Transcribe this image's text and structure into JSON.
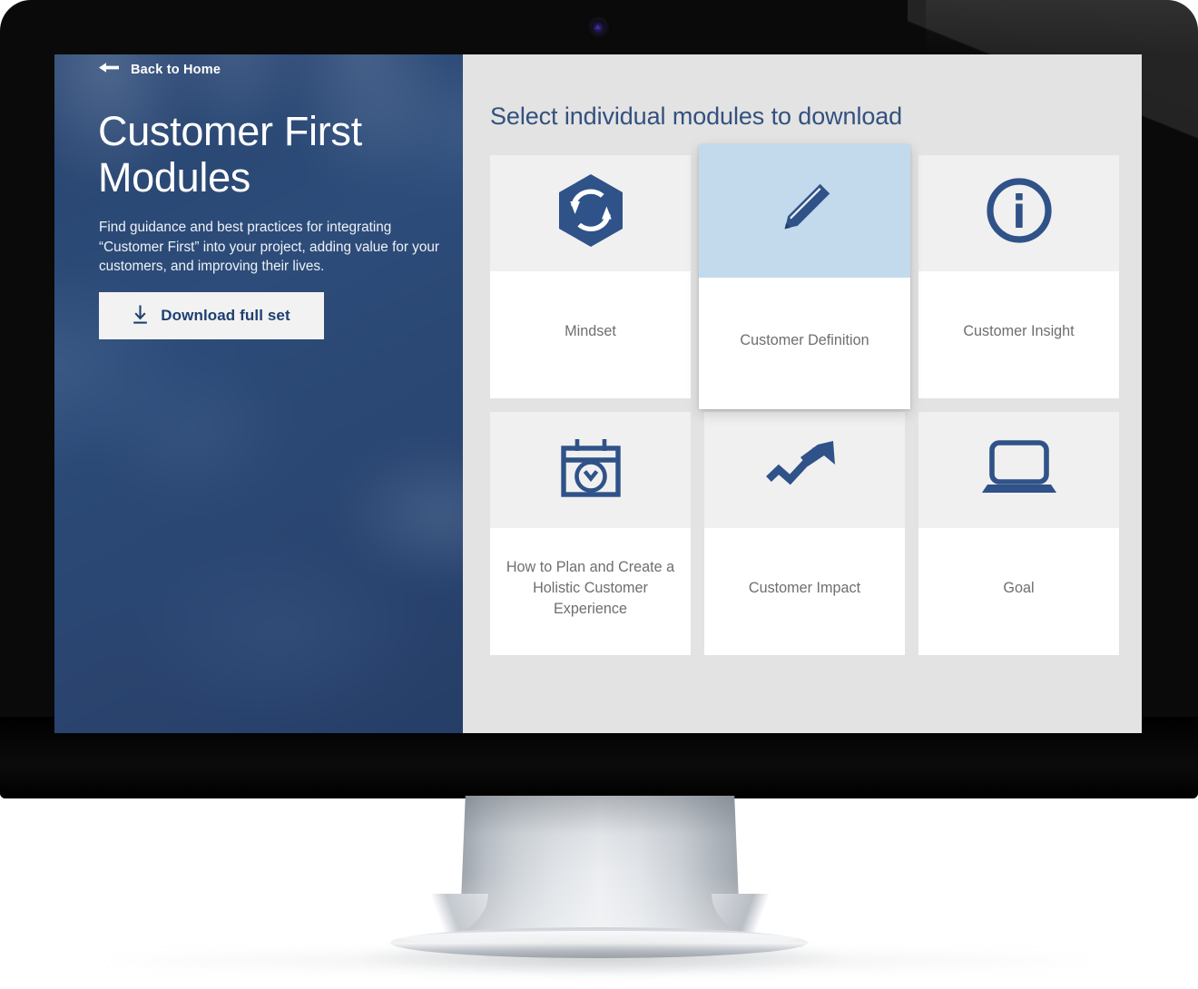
{
  "hero": {
    "back_link_label": "Back to Home",
    "back_arrow_icon": "arrow-left-icon",
    "title": "Customer First Modules",
    "description": "Find guidance and best practices for integrating “Customer First” into your project, adding value for your customers, and improving their lives.",
    "download_button_label": "Download full set",
    "download_button_icon": "download-icon",
    "background_color": "#2a4670",
    "text_color": "#ffffff"
  },
  "content": {
    "heading": "Select individual modules to download",
    "heading_color": "#33517f",
    "background_color": "#e3e3e3",
    "modules": [
      {
        "label": "Mindset",
        "icon": "hexagon-cycle-arrows-icon",
        "selected": false
      },
      {
        "label": "Customer Definition",
        "icon": "pencil-icon",
        "selected": true
      },
      {
        "label": "Customer Insight",
        "icon": "info-circle-icon",
        "selected": false
      },
      {
        "label": "How to Plan and Create a Holistic Customer Experience",
        "icon": "calendar-clock-icon",
        "selected": false
      },
      {
        "label": "Customer Impact",
        "icon": "trending-up-arrow-icon",
        "selected": false
      },
      {
        "label": "Goal",
        "icon": "laptop-icon",
        "selected": false
      }
    ],
    "accent_color": "#2f5288",
    "selected_tile_color": "#c3daed",
    "tile_icon_bg_color": "#f0f0f0",
    "tile_label_color": "#6e6e6e"
  },
  "device": {
    "type": "desktop-monitor",
    "bezel_color": "#0a0a0a",
    "stand_color": "#cdd2d8",
    "webcam_icon": "webcam-icon"
  }
}
